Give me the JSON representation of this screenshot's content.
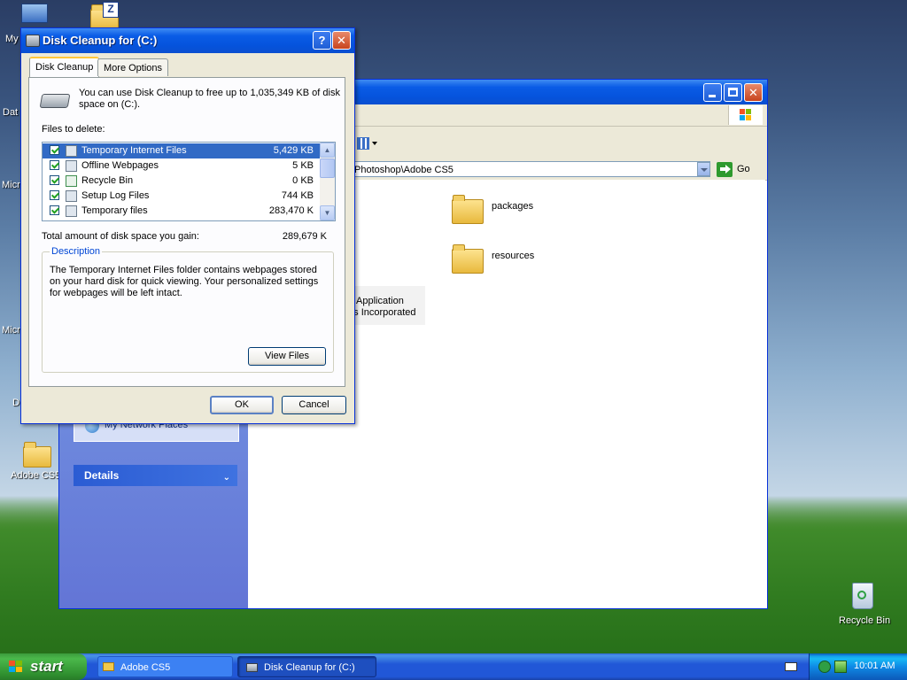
{
  "desktop": {
    "icons": [
      {
        "label": "My"
      },
      {
        "label": "Dat"
      },
      {
        "label": "Micr"
      },
      {
        "label": "Micr"
      },
      {
        "label": "D"
      },
      {
        "label": "Adobe CS5"
      },
      {
        "label": "Recycle Bin"
      }
    ]
  },
  "explorer": {
    "address_value": "Photoshop\\Adobe CS5",
    "go_label": "Go",
    "folders": [
      {
        "label": "packages"
      },
      {
        "label": "resources"
      }
    ],
    "app_item": {
      "line1": "Application",
      "line2": "ms Incorporated"
    },
    "left_pane": {
      "network_places": "My Network Places",
      "details_header": "Details"
    }
  },
  "dialog": {
    "title": "Disk Cleanup for  (C:)",
    "tabs": [
      {
        "label": "Disk Cleanup"
      },
      {
        "label": "More Options"
      }
    ],
    "intro_text": "You can use Disk Cleanup to free up to 1,035,349 KB of disk space on  (C:).",
    "files_label": "Files to delete:",
    "files": [
      {
        "name": "Temporary Internet Files",
        "size": "5,429 KB"
      },
      {
        "name": "Offline Webpages",
        "size": "5 KB"
      },
      {
        "name": "Recycle Bin",
        "size": "0 KB"
      },
      {
        "name": "Setup Log Files",
        "size": "744 KB"
      },
      {
        "name": "Temporary files",
        "size": "283,470 K"
      }
    ],
    "total_label": "Total amount of disk space you gain:",
    "total_value": "289,679 K",
    "description_legend": "Description",
    "description_text": "The Temporary Internet Files folder contains webpages stored on your hard disk for quick viewing. Your personalized settings for webpages will be left intact.",
    "view_files_label": "View Files",
    "ok_label": "OK",
    "cancel_label": "Cancel",
    "help_glyph": "?",
    "close_glyph": "✕"
  },
  "taskbar": {
    "start_label": "start",
    "buttons": [
      {
        "label": "Adobe CS5"
      },
      {
        "label": "Disk Cleanup for  (C:)"
      }
    ],
    "clock": "10:01 AM"
  },
  "colors": {
    "xp_title_blue": "#0553dc",
    "selection_blue": "#316ac5",
    "start_green": "#3c9b3c"
  }
}
